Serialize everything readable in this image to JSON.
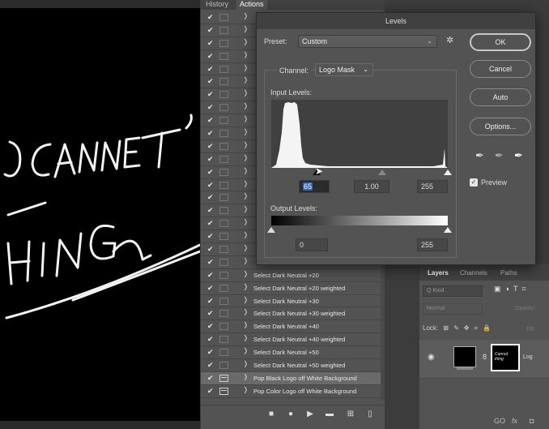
{
  "actions_panel": {
    "tabs": [
      "History",
      "Actions"
    ],
    "rows": [
      {
        "label": "",
        "dialog": false,
        "selected": false
      },
      {
        "label": "",
        "dialog": false,
        "selected": false
      },
      {
        "label": "",
        "dialog": false,
        "selected": false
      },
      {
        "label": "",
        "dialog": false,
        "selected": false
      },
      {
        "label": "",
        "dialog": false,
        "selected": false
      },
      {
        "label": "",
        "dialog": false,
        "selected": false
      },
      {
        "label": "",
        "dialog": false,
        "selected": false
      },
      {
        "label": "",
        "dialog": false,
        "selected": false
      },
      {
        "label": "",
        "dialog": false,
        "selected": false
      },
      {
        "label": "",
        "dialog": false,
        "selected": false
      },
      {
        "label": "",
        "dialog": false,
        "selected": false
      },
      {
        "label": "",
        "dialog": false,
        "selected": false
      },
      {
        "label": "",
        "dialog": false,
        "selected": false
      },
      {
        "label": "",
        "dialog": false,
        "selected": false
      },
      {
        "label": "",
        "dialog": false,
        "selected": false
      },
      {
        "label": "",
        "dialog": false,
        "selected": false
      },
      {
        "label": "",
        "dialog": false,
        "selected": false
      },
      {
        "label": "",
        "dialog": false,
        "selected": false
      },
      {
        "label": "",
        "dialog": false,
        "selected": false
      },
      {
        "label": "",
        "dialog": false,
        "selected": false
      },
      {
        "label": "Select Dark Neutral +20",
        "dialog": false,
        "selected": false
      },
      {
        "label": "Select Dark Neutral +20 weighted",
        "dialog": false,
        "selected": false
      },
      {
        "label": "Select Dark Neutral +30",
        "dialog": false,
        "selected": false
      },
      {
        "label": "Select Dark Neutral +30 weighted",
        "dialog": false,
        "selected": false
      },
      {
        "label": "Select Dark Neutral +40",
        "dialog": false,
        "selected": false
      },
      {
        "label": "Select Dark Neutral +40 weighted",
        "dialog": false,
        "selected": false
      },
      {
        "label": "Select Dark Neutral +50",
        "dialog": false,
        "selected": false
      },
      {
        "label": "Select Dark Neutral +50 weighted",
        "dialog": false,
        "selected": false
      },
      {
        "label": "Pop Black Logo off White Background",
        "dialog": true,
        "selected": true
      },
      {
        "label": "Pop Color Logo off White Background",
        "dialog": true,
        "selected": false
      }
    ],
    "footer_icons": [
      "stop-icon",
      "record-icon",
      "play-icon",
      "folder-icon",
      "new-action-icon",
      "trash-icon"
    ]
  },
  "levels_dialog": {
    "title": "Levels",
    "preset_label": "Preset:",
    "preset_value": "Custom",
    "channel_label": "Channel:",
    "channel_value": "Logo Mask",
    "input_levels_label": "Input Levels:",
    "input_black": "65",
    "input_gamma": "1.00",
    "input_white": "255",
    "input_black_level": 65,
    "input_gamma_value": 1.0,
    "input_white_level": 255,
    "output_levels_label": "Output Levels:",
    "output_black": "0",
    "output_white": "255",
    "output_black_level": 0,
    "output_white_level": 255,
    "histogram_peak_range": [
      8,
      38
    ],
    "buttons": {
      "ok": "OK",
      "cancel": "Cancel",
      "auto": "Auto",
      "options": "Options..."
    },
    "preview_label": "Preview",
    "preview_checked": true
  },
  "layers_panel": {
    "tabs": [
      "Layers",
      "Channels",
      "Paths"
    ],
    "kind_placeholder": "Q Kind",
    "blend_mode": "Normal",
    "opacity_label": "Opacity:",
    "lock_label": "Lock:",
    "fill_label": "Fill:",
    "layer_name": "Log",
    "mask_text": "Cannot thing",
    "footer_icons": [
      "GO",
      "fx",
      "mask-icon"
    ]
  },
  "canvas_text": "CANNOT THING",
  "colors": {
    "accent": "#2d64b4",
    "panel": "#535353",
    "dark": "#2b2b2b"
  }
}
